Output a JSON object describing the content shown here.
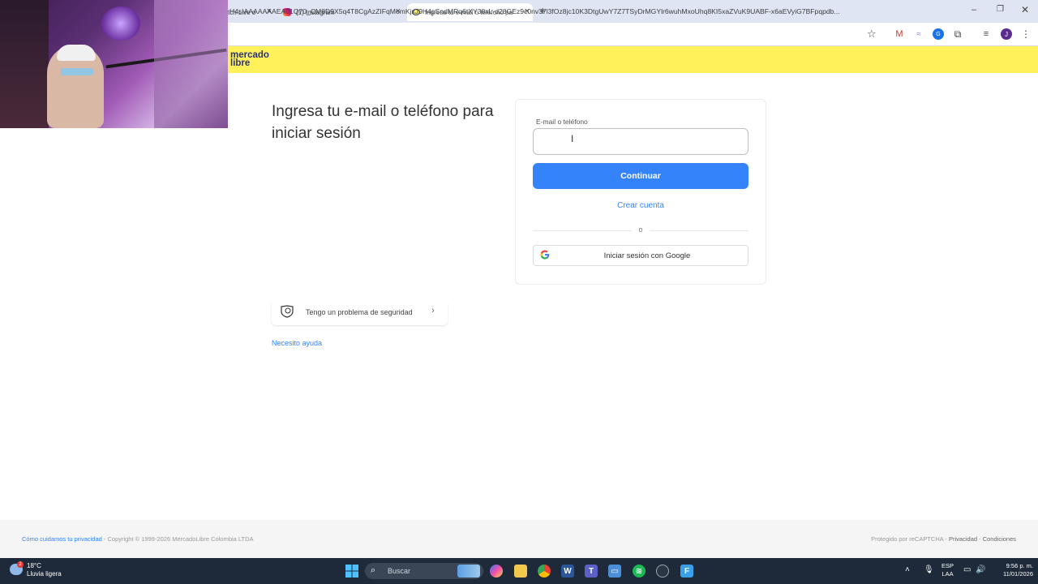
{
  "browser": {
    "tabs": [
      {
        "label": "tch Live o"
      },
      {
        "label": "(1) Instagram"
      },
      {
        "label": "Ingresa tu e-mail o teléfono pa"
      }
    ],
    "url": "H4sIAAAAAAAEA01Q70_CM8D9X5q4T8CgAzZIFqMomKjxJ9H4pSndMRq6tXY38xL-d28GEz9c0nv37l3fOz8jc10K3DtgUwY7Z7TSyDrMGYlr6wuhMxoUhq8KI5xaZVuK9UABF-x6aEVyiG7BFpqpdb..."
  },
  "ml": {
    "logo_line1": "mercado",
    "logo_line2": "libre",
    "heading": "Ingresa tu e-mail o teléfono para iniciar sesión",
    "email_label": "E-mail o teléfono",
    "email_value": "",
    "continue_label": "Continuar",
    "create_account": "Crear cuenta",
    "or_label": "o",
    "google_label": "Iniciar sesión con Google",
    "security_label": "Tengo un problema de seguridad",
    "help_label": "Necesito ayuda"
  },
  "footer": {
    "privacy_link": "Cómo cuidamos tu privacidad",
    "copyright": " - Copyright © 1999-2026 MercadoLibre Colombia LTDA",
    "recaptcha": "Protegido por reCAPTCHA - ",
    "privacy": "Privacidad",
    "separator": " - ",
    "terms": "Condiciones"
  },
  "taskbar": {
    "temperature": "18°C",
    "weather": "Lluvia ligera",
    "search_placeholder": "Buscar",
    "lang_line1": "ESP",
    "lang_line2": "LAA",
    "time": "9:56 p. m.",
    "date": "11/01/2026"
  },
  "colors": {
    "ml_yellow": "#fff159",
    "ml_blue": "#3483fa",
    "taskbar": "#1e2a3a"
  }
}
